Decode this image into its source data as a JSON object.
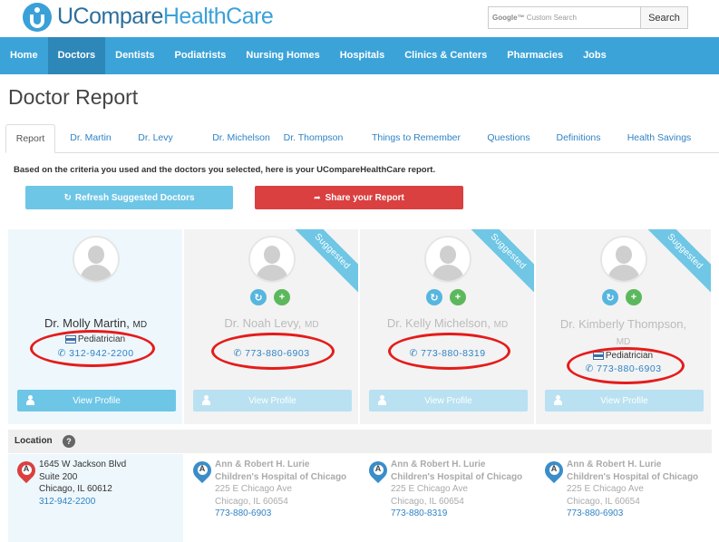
{
  "brand": {
    "name_part1": "UCompare",
    "name_part2": "HealthCare"
  },
  "search": {
    "google": "Google™",
    "placeholder": "Custom Search",
    "button": "Search"
  },
  "nav": [
    "Home",
    "Doctors",
    "Dentists",
    "Podiatrists",
    "Nursing Homes",
    "Hospitals",
    "Clinics & Centers",
    "Pharmacies",
    "Jobs"
  ],
  "nav_active": "Doctors",
  "page_title": "Doctor Report",
  "tabs": [
    "Report",
    "Dr. Martin",
    "Dr. Levy",
    "Dr. Michelson",
    "Dr. Thompson",
    "Things to Remember",
    "Questions",
    "Definitions",
    "Health Savings"
  ],
  "intro": "Based on the criteria you used and the doctors you selected, here is your UCompareHealthCare report.",
  "buttons": {
    "refresh": "Refresh Suggested Doctors",
    "share": "Share your Report"
  },
  "doctors": [
    {
      "name": "Dr. Molly Martin,",
      "suffix": "MD",
      "specialty": "Pediatrician",
      "phone": "312-942-2200",
      "suggested": false,
      "view": "View Profile"
    },
    {
      "name": "Dr. Noah Levy,",
      "suffix": "MD",
      "specialty": "",
      "phone": "773-880-6903",
      "suggested": true,
      "ribbon": "Suggested",
      "view": "View Profile"
    },
    {
      "name": "Dr. Kelly Michelson,",
      "suffix": "MD",
      "specialty": "",
      "phone": "773-880-8319",
      "suggested": true,
      "ribbon": "Suggested",
      "view": "View Profile"
    },
    {
      "name": "Dr. Kimberly Thompson,",
      "suffix": "MD",
      "specialty": "Pediatrician",
      "phone": "773-880-6903",
      "suggested": true,
      "ribbon": "Suggested",
      "view": "View Profile"
    }
  ],
  "location": {
    "title": "Location",
    "help": "?",
    "items": [
      {
        "pin": "A",
        "hospital": "",
        "lines": [
          "1645 W Jackson Blvd",
          "Suite 200",
          "Chicago, IL 60612"
        ],
        "phone": "312-942-2200"
      },
      {
        "pin": "A",
        "hospital": "Ann & Robert H. Lurie Children's Hospital of Chicago",
        "lines": [
          "225 E Chicago Ave",
          "Chicago, IL 60654"
        ],
        "phone": "773-880-6903"
      },
      {
        "pin": "A",
        "hospital": "Ann & Robert H. Lurie Children's Hospital of Chicago",
        "lines": [
          "225 E Chicago Ave",
          "Chicago, IL 60654"
        ],
        "phone": "773-880-8319"
      },
      {
        "pin": "A",
        "hospital": "Ann & Robert H. Lurie Children's Hospital of Chicago",
        "lines": [
          "225 E Chicago Ave",
          "Chicago, IL 60654"
        ],
        "phone": "773-880-6903"
      }
    ]
  },
  "colors": {
    "nav": "#3ba3d8",
    "nav_active": "#2d87b8",
    "refresh": "#6ec6e6",
    "share": "#d9403f",
    "link": "#2f83c5",
    "highlight": "#e51b1b"
  }
}
